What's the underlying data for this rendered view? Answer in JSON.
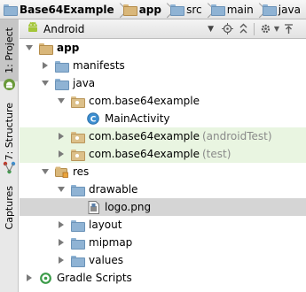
{
  "breadcrumb": [
    {
      "label": "Base64Example",
      "icon": "folder-icon",
      "bold": true
    },
    {
      "label": "app",
      "icon": "module-folder-icon",
      "bold": true
    },
    {
      "label": "src",
      "icon": "folder-icon",
      "bold": false
    },
    {
      "label": "main",
      "icon": "folder-icon",
      "bold": false
    },
    {
      "label": "java",
      "icon": "source-folder-icon",
      "bold": false
    }
  ],
  "left_strip": {
    "tabs": [
      {
        "label": "1: Project",
        "active": true
      },
      {
        "label": "7: Structure",
        "active": false
      },
      {
        "label": "Captures",
        "active": false
      }
    ]
  },
  "panel_header": {
    "view_selector": "Android",
    "buttons": [
      "target-icon",
      "collapse-all-icon",
      "gear-icon",
      "hide-icon"
    ]
  },
  "tree": [
    {
      "label": "app",
      "bold": true,
      "suffix": "",
      "icon": "module-folder-icon",
      "expand": "open",
      "level": 0,
      "state": ""
    },
    {
      "label": "manifests",
      "bold": false,
      "suffix": "",
      "icon": "folder-icon",
      "expand": "closed",
      "level": 1,
      "state": ""
    },
    {
      "label": "java",
      "bold": false,
      "suffix": "",
      "icon": "source-folder-icon",
      "expand": "open",
      "level": 1,
      "state": ""
    },
    {
      "label": "com.base64example",
      "bold": false,
      "suffix": "",
      "icon": "package-icon",
      "expand": "open",
      "level": 2,
      "state": ""
    },
    {
      "label": "MainActivity",
      "bold": false,
      "suffix": "",
      "icon": "class-icon",
      "expand": "none",
      "level": 3,
      "state": ""
    },
    {
      "label": "com.base64example",
      "bold": false,
      "suffix": "(androidTest)",
      "icon": "package-icon",
      "expand": "closed",
      "level": 2,
      "state": "test"
    },
    {
      "label": "com.base64example",
      "bold": false,
      "suffix": "(test)",
      "icon": "package-icon",
      "expand": "closed",
      "level": 2,
      "state": "test"
    },
    {
      "label": "res",
      "bold": false,
      "suffix": "",
      "icon": "resource-folder-icon",
      "expand": "open",
      "level": 1,
      "state": ""
    },
    {
      "label": "drawable",
      "bold": false,
      "suffix": "",
      "icon": "folder-icon",
      "expand": "open",
      "level": 2,
      "state": ""
    },
    {
      "label": "logo.png",
      "bold": false,
      "suffix": "",
      "icon": "image-file-icon",
      "expand": "none",
      "level": 3,
      "state": "selected"
    },
    {
      "label": "layout",
      "bold": false,
      "suffix": "",
      "icon": "folder-icon",
      "expand": "closed",
      "level": 2,
      "state": ""
    },
    {
      "label": "mipmap",
      "bold": false,
      "suffix": "",
      "icon": "folder-icon",
      "expand": "closed",
      "level": 2,
      "state": ""
    },
    {
      "label": "values",
      "bold": false,
      "suffix": "",
      "icon": "folder-icon",
      "expand": "closed",
      "level": 2,
      "state": ""
    },
    {
      "label": "Gradle Scripts",
      "bold": false,
      "suffix": "",
      "icon": "gradle-icon",
      "expand": "closed",
      "level": 0,
      "state": ""
    }
  ],
  "colors": {
    "accent_green": "#a4c639",
    "test_highlight": "#e9f5e1",
    "selection": "#d5d5d5",
    "class_icon_blue": "#3d8fd1"
  }
}
